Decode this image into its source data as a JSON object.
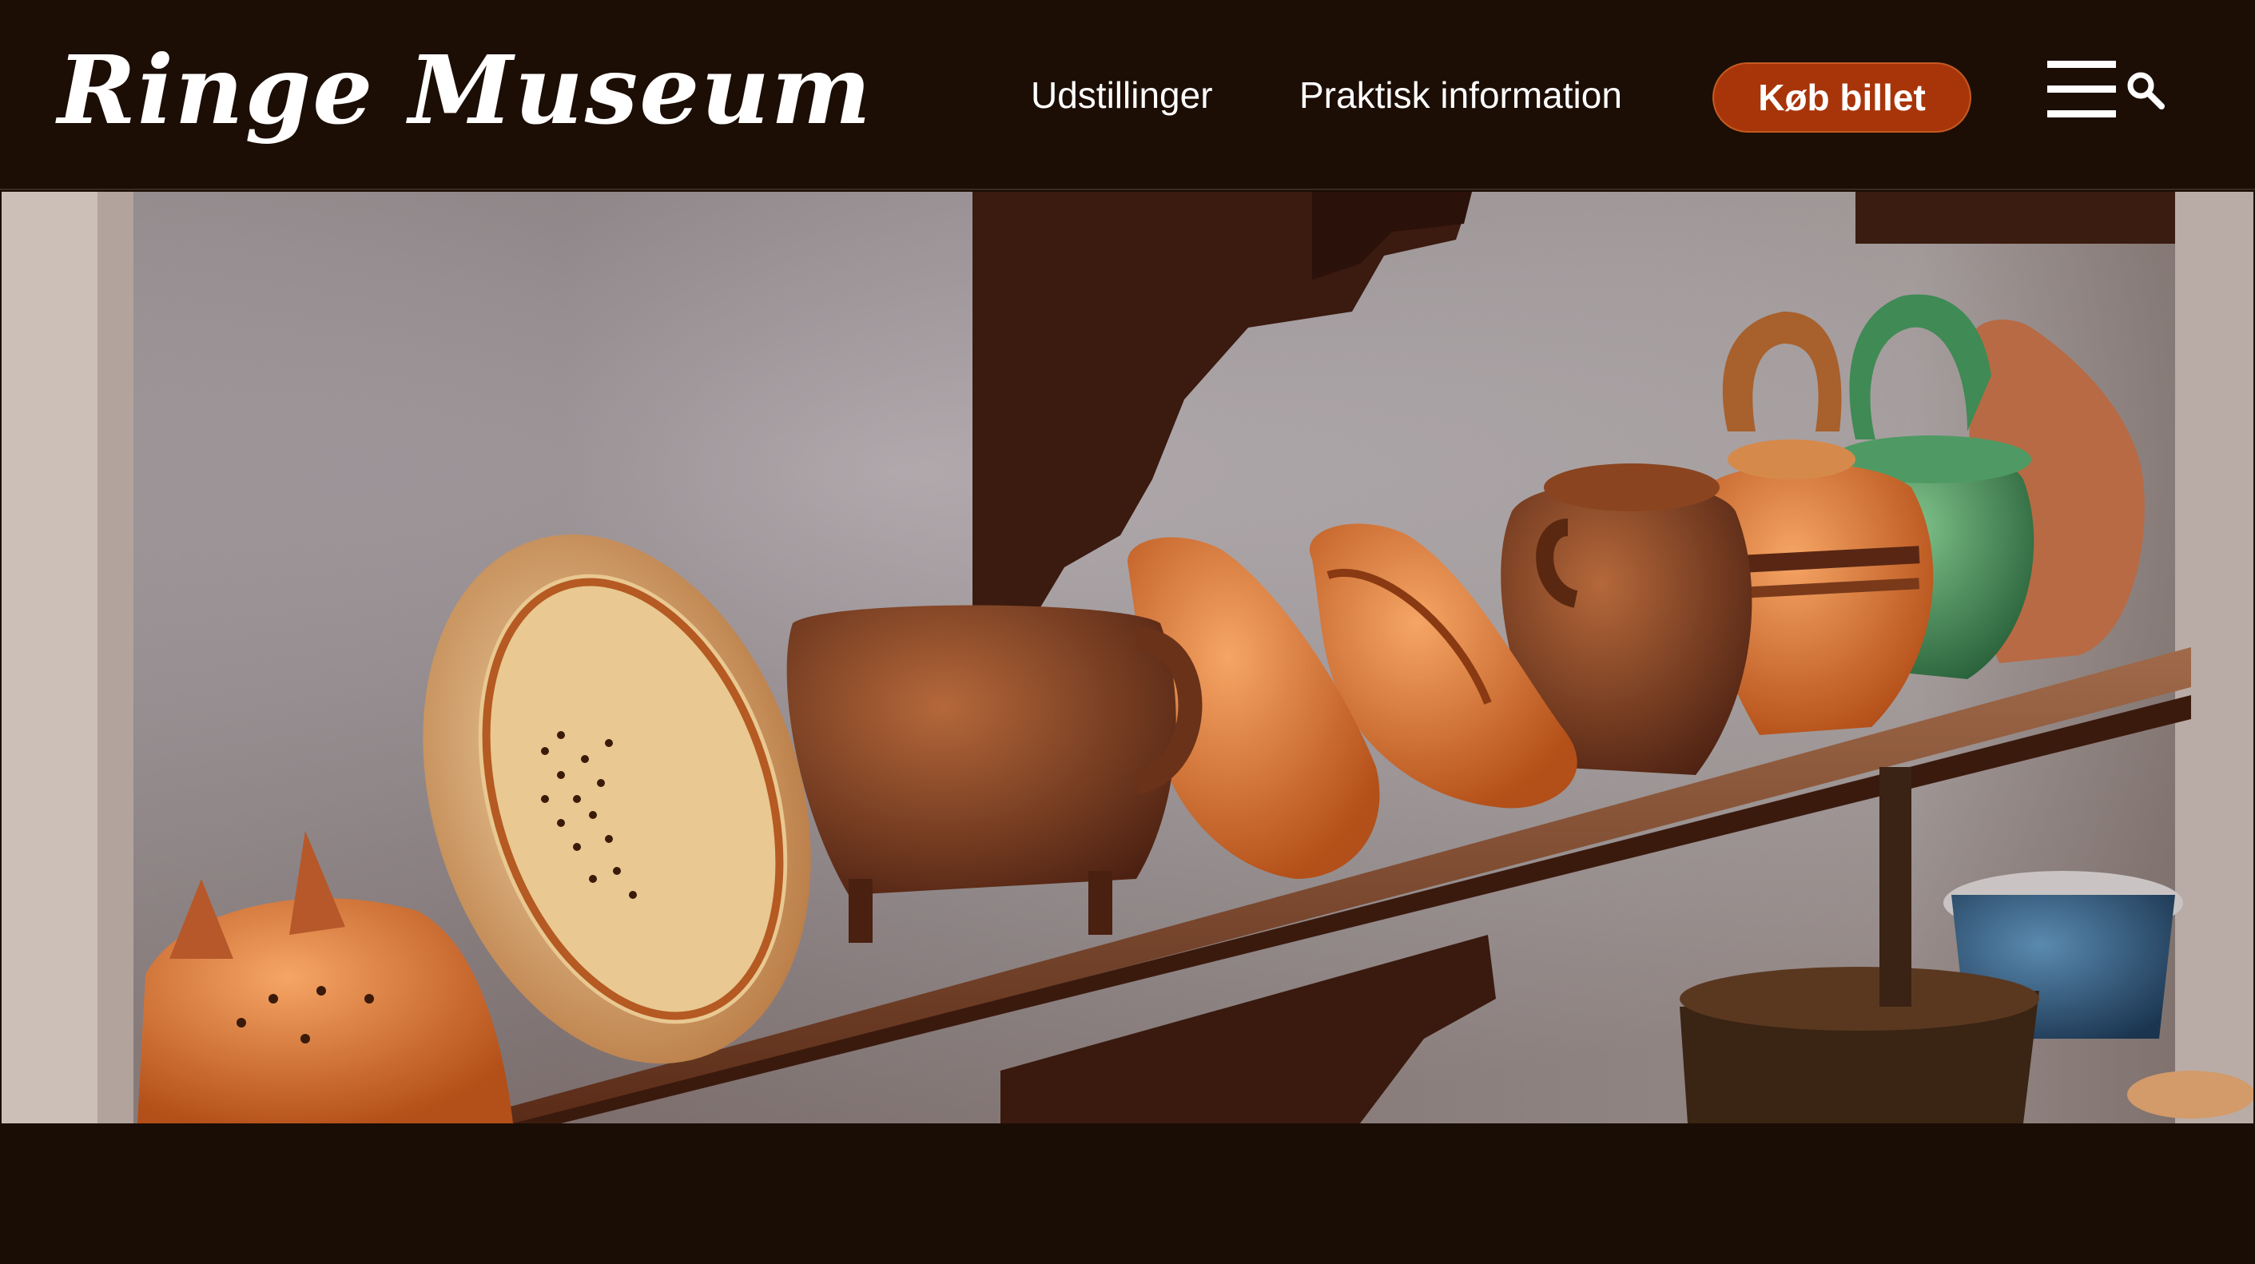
{
  "header": {
    "logo_text": "Ringe Museum",
    "nav": [
      {
        "label": "Udstillinger"
      },
      {
        "label": "Praktisk information"
      }
    ],
    "buy_button_label": "Køb billet",
    "icons": {
      "menu": "hamburger-menu-icon",
      "search": "search-icon"
    }
  },
  "hero": {
    "image_subject": "hero-photo"
  },
  "colors": {
    "header_bg": "#1c0e05",
    "accent_button": "#a8350a",
    "text": "#ffffff"
  }
}
